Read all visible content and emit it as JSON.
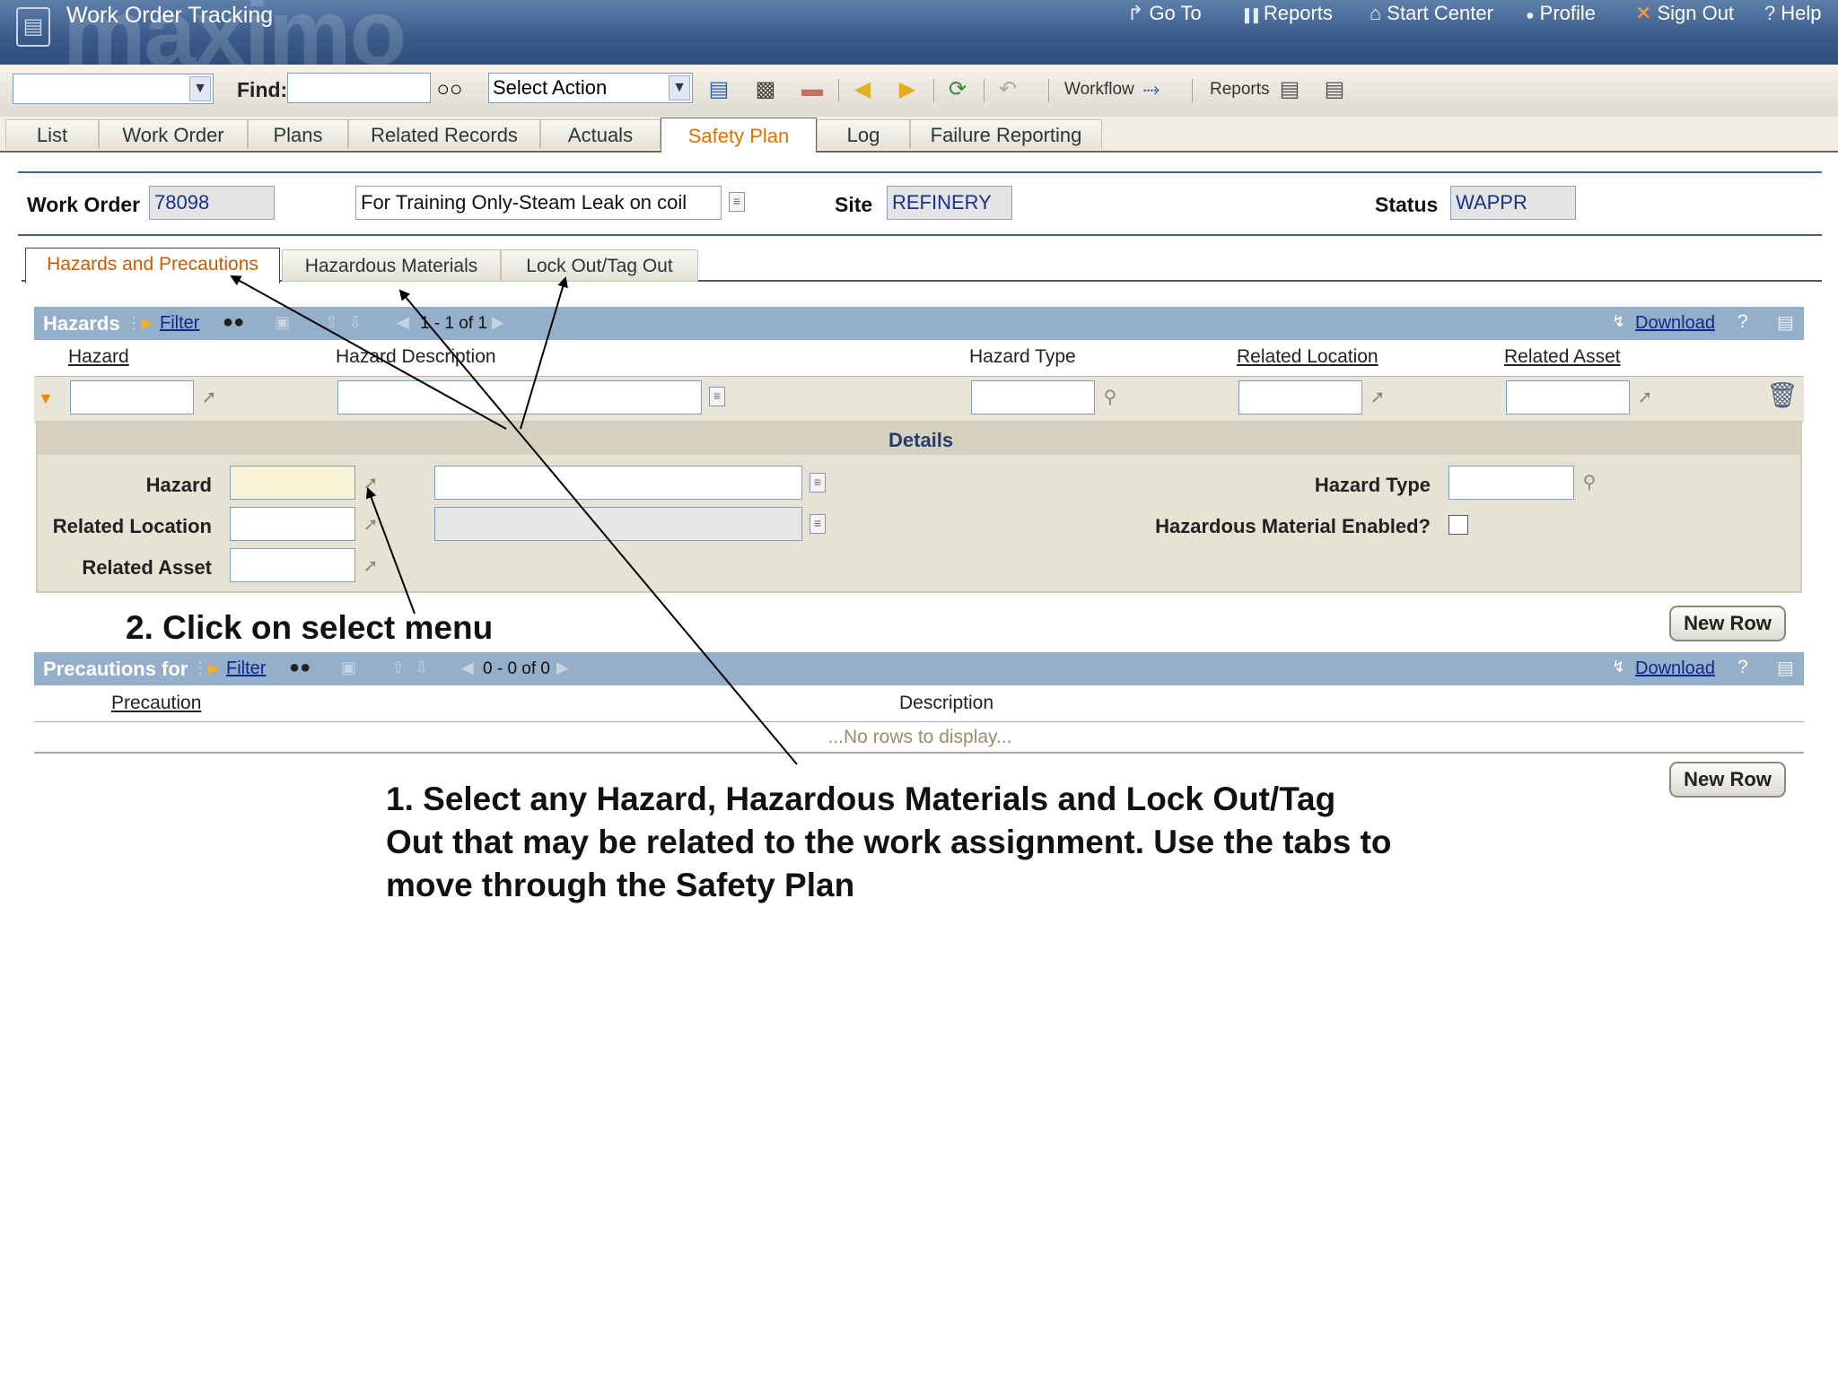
{
  "app": {
    "title": "Work Order Tracking",
    "brand": "maximo",
    "top_links": [
      "Go To",
      "Reports",
      "Start Center",
      "Profile",
      "Sign Out",
      "Help"
    ],
    "top_link_glyphs": [
      "↱",
      "▐▐",
      "⌂",
      "●",
      "✕",
      "?"
    ]
  },
  "toolbar": {
    "find_label": "Find:",
    "find_value": "",
    "query_select": "",
    "action_select": "Select Action",
    "workflow_label": "Workflow",
    "reports_label": "Reports"
  },
  "main_tabs": [
    "List",
    "Work Order",
    "Plans",
    "Related Records",
    "Actuals",
    "Safety Plan",
    "Log",
    "Failure Reporting"
  ],
  "active_main_tab": "Safety Plan",
  "header": {
    "work_order_label": "Work Order",
    "work_order_value": "78098",
    "description_value": "For Training Only-Steam Leak on coil",
    "site_label": "Site",
    "site_value": "REFINERY",
    "status_label": "Status",
    "status_value": "WAPPR"
  },
  "sub_tabs": [
    "Hazards and Precautions",
    "Hazardous Materials",
    "Lock Out/Tag Out"
  ],
  "hazards_table": {
    "title": "Hazards",
    "filter_label": "Filter",
    "pagination": "1 - 1 of 1",
    "download_label": "Download",
    "help_glyph": "?",
    "columns": [
      "Hazard",
      "Hazard Description",
      "Hazard Type",
      "Related Location",
      "Related Asset"
    ]
  },
  "details": {
    "title": "Details",
    "hazard_label": "Hazard",
    "related_location_label": "Related Location",
    "related_asset_label": "Related Asset",
    "hazard_type_label": "Hazard Type",
    "hazmat_enabled_label": "Hazardous Material Enabled?",
    "hazmat_enabled": false
  },
  "new_row_label": "New Row",
  "precautions_table": {
    "title": "Precautions for",
    "filter_label": "Filter",
    "pagination": "0 - 0 of 0",
    "download_label": "Download",
    "help_glyph": "?",
    "columns": [
      "Precaution",
      "Description"
    ],
    "empty_text": "...No rows to display..."
  },
  "annotations": {
    "step2": "2. Click on select menu",
    "step1_lines": [
      "1. Select any Hazard, Hazardous Materials and Lock Out/Tag",
      "Out that may be related to the work assignment. Use the tabs to",
      "move through the Safety Plan"
    ]
  }
}
